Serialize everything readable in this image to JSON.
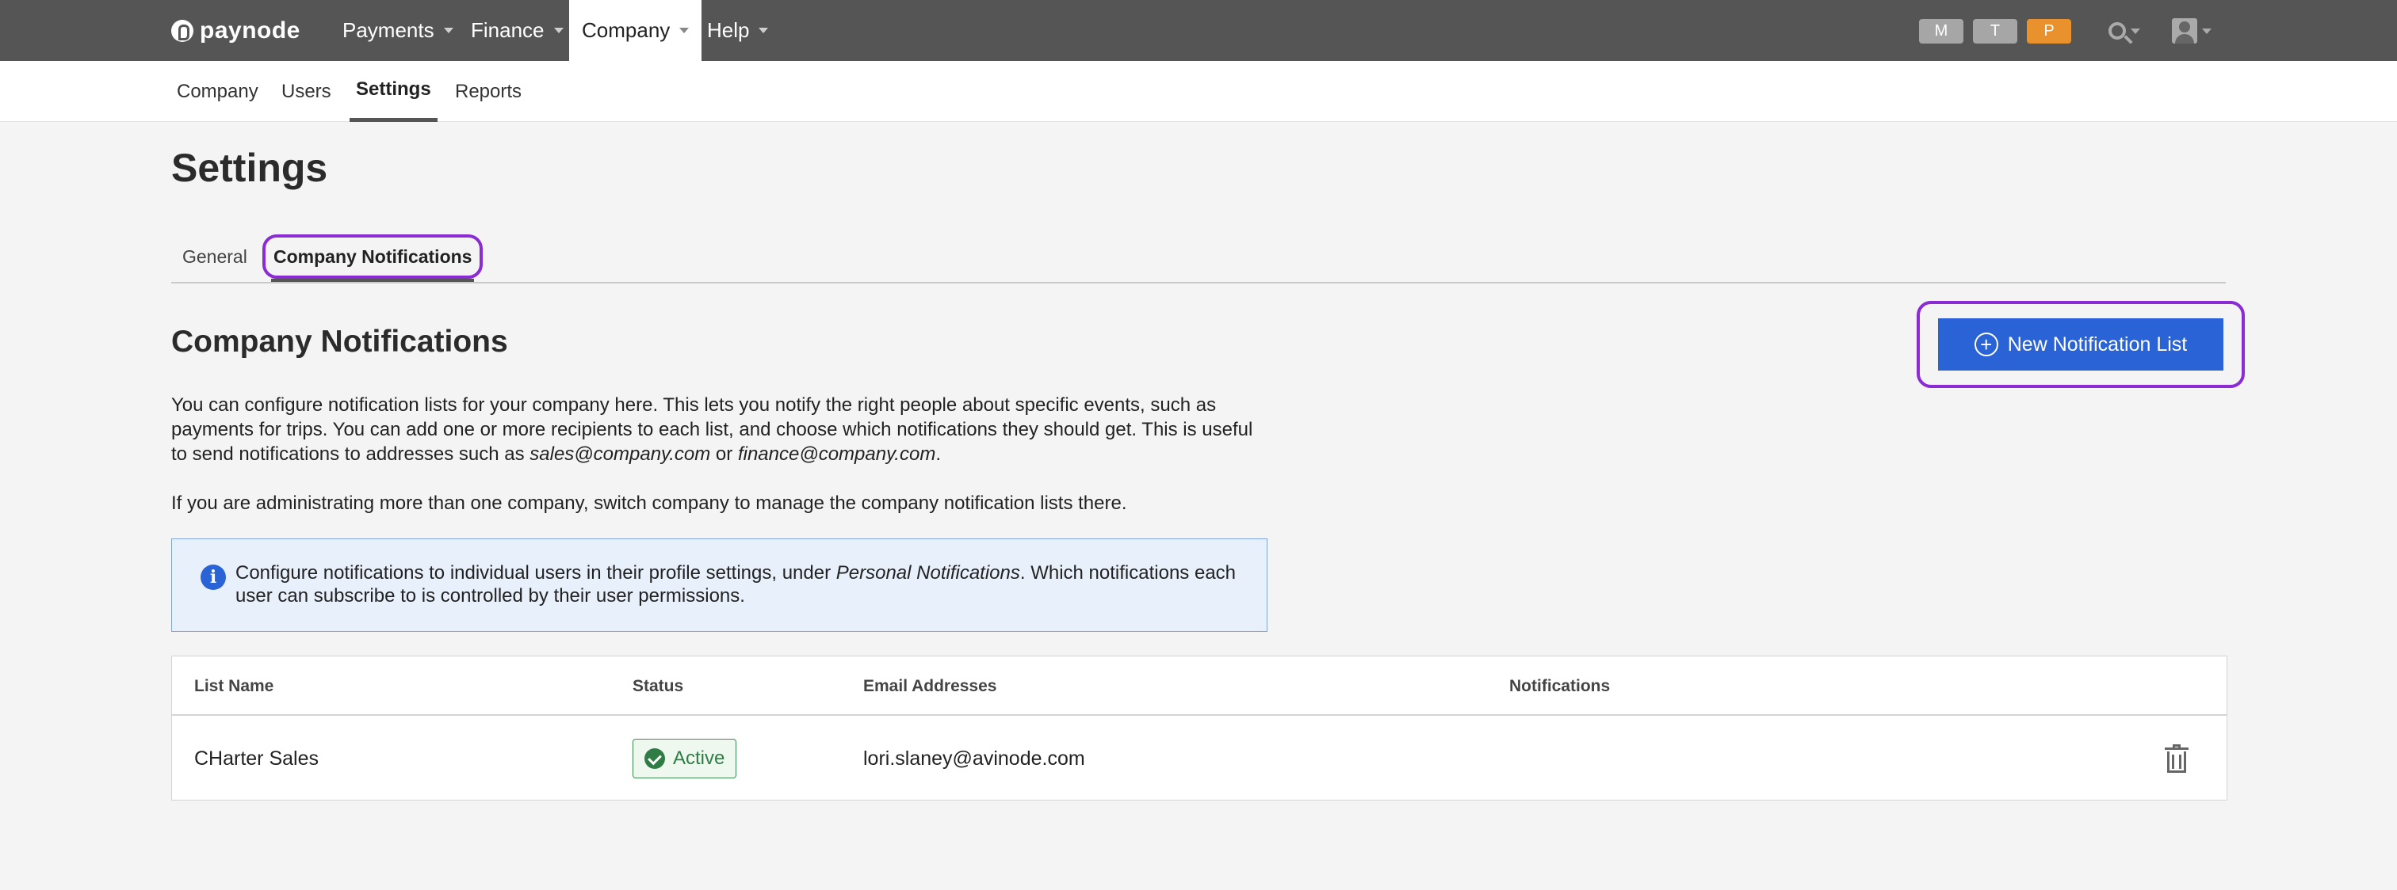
{
  "topnav": {
    "logo": "paynode",
    "items": [
      {
        "label": "Payments",
        "active": false
      },
      {
        "label": "Finance",
        "active": false
      },
      {
        "label": "Company",
        "active": true
      },
      {
        "label": "Help",
        "active": false
      }
    ],
    "badges": [
      {
        "label": "M",
        "color": "#a6a6a6"
      },
      {
        "label": "T",
        "color": "#a6a6a6"
      },
      {
        "label": "P",
        "color": "#e8912d"
      }
    ],
    "icons": [
      "search-icon",
      "user-icon"
    ]
  },
  "subnav": {
    "items": [
      {
        "label": "Company",
        "active": false
      },
      {
        "label": "Users",
        "active": false
      },
      {
        "label": "Settings",
        "active": true
      },
      {
        "label": "Reports",
        "active": false
      }
    ]
  },
  "page": {
    "title": "Settings",
    "tabs": [
      {
        "label": "General",
        "active": false
      },
      {
        "label": "Company Notifications",
        "active": true
      }
    ]
  },
  "section": {
    "title": "Company Notifications",
    "new_button_label": "New Notification List",
    "description_part1": "You can configure notification lists for your company here. This lets you notify the right people about specific events, such as payments for trips. You can add one or more recipients to each list, and choose which notifications they should get. This is useful to send notifications to addresses such as ",
    "example_email_1": "sales@company.com",
    "description_or": " or ",
    "example_email_2": "finance@company.com",
    "description_end": ".",
    "description2": "If you are administrating more than one company, switch company to manage the company notification lists there.",
    "info_part1": "Configure notifications to individual users in their profile settings, under ",
    "info_emphasis": "Personal Notifications",
    "info_part2": ". Which notifications each user can subscribe to is controlled by their user permissions."
  },
  "table": {
    "headers": {
      "list_name": "List Name",
      "status": "Status",
      "email_addresses": "Email Addresses",
      "notifications": "Notifications"
    },
    "rows": [
      {
        "list_name": "CHarter Sales",
        "status": "Active",
        "email": "lori.slaney@avinode.com",
        "notifications": ""
      }
    ]
  },
  "colors": {
    "accent_blue": "#2a63d6",
    "highlight_purple": "#8b2bd6",
    "status_green": "#2f7d45",
    "topbar": "#555555"
  }
}
